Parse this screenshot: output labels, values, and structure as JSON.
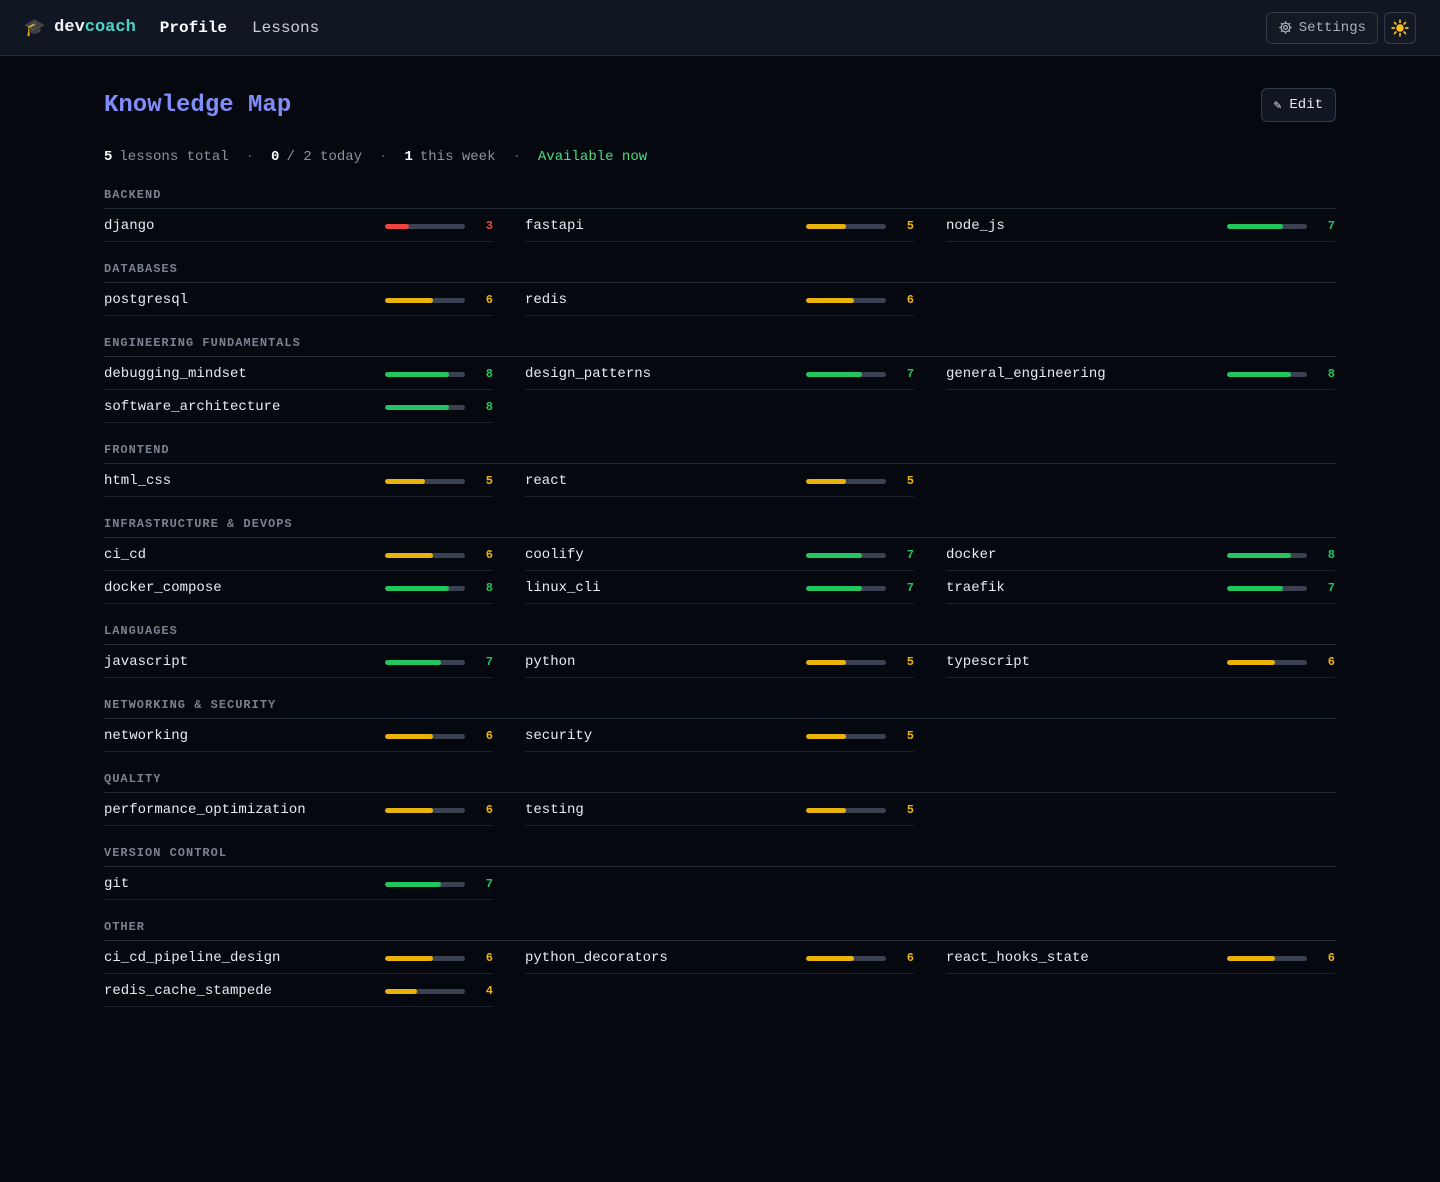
{
  "brand": {
    "icon": "graduation-cap-icon",
    "part1": "dev",
    "part2": "coach"
  },
  "nav": [
    {
      "label": "Profile",
      "active": true
    },
    {
      "label": "Lessons",
      "active": false
    }
  ],
  "header": {
    "settings_label": "Settings",
    "settings_icon": "gear-icon",
    "theme_icon": "sun-icon"
  },
  "page": {
    "title": "Knowledge Map",
    "edit_label": "Edit",
    "edit_icon": "pencil-icon"
  },
  "stats": {
    "lessons_total": "5",
    "lessons_total_label": "lessons total",
    "today_done": "0",
    "today_of": "/ 2 today",
    "week_count": "1",
    "week_label": "this week",
    "availability": "Available now"
  },
  "scale_max": 10,
  "colors": {
    "low": "#ef4444",
    "mid": "#eab308",
    "high": "#22c55e",
    "accent": "#818cf8",
    "brand": "#4fd1c5"
  },
  "sections": [
    {
      "title": "BACKEND",
      "skills": [
        {
          "name": "django",
          "score": 3
        },
        {
          "name": "fastapi",
          "score": 5
        },
        {
          "name": "node_js",
          "score": 7
        }
      ]
    },
    {
      "title": "DATABASES",
      "skills": [
        {
          "name": "postgresql",
          "score": 6
        },
        {
          "name": "redis",
          "score": 6
        }
      ]
    },
    {
      "title": "ENGINEERING FUNDAMENTALS",
      "skills": [
        {
          "name": "debugging_mindset",
          "score": 8
        },
        {
          "name": "design_patterns",
          "score": 7
        },
        {
          "name": "general_engineering",
          "score": 8
        },
        {
          "name": "software_architecture",
          "score": 8
        }
      ]
    },
    {
      "title": "FRONTEND",
      "skills": [
        {
          "name": "html_css",
          "score": 5
        },
        {
          "name": "react",
          "score": 5
        }
      ]
    },
    {
      "title": "INFRASTRUCTURE & DEVOPS",
      "skills": [
        {
          "name": "ci_cd",
          "score": 6
        },
        {
          "name": "coolify",
          "score": 7
        },
        {
          "name": "docker",
          "score": 8
        },
        {
          "name": "docker_compose",
          "score": 8
        },
        {
          "name": "linux_cli",
          "score": 7
        },
        {
          "name": "traefik",
          "score": 7
        }
      ]
    },
    {
      "title": "LANGUAGES",
      "skills": [
        {
          "name": "javascript",
          "score": 7
        },
        {
          "name": "python",
          "score": 5
        },
        {
          "name": "typescript",
          "score": 6
        }
      ]
    },
    {
      "title": "NETWORKING & SECURITY",
      "skills": [
        {
          "name": "networking",
          "score": 6
        },
        {
          "name": "security",
          "score": 5
        }
      ]
    },
    {
      "title": "QUALITY",
      "skills": [
        {
          "name": "performance_optimization",
          "score": 6
        },
        {
          "name": "testing",
          "score": 5
        }
      ]
    },
    {
      "title": "VERSION CONTROL",
      "skills": [
        {
          "name": "git",
          "score": 7
        }
      ]
    },
    {
      "title": "OTHER",
      "skills": [
        {
          "name": "ci_cd_pipeline_design",
          "score": 6
        },
        {
          "name": "python_decorators",
          "score": 6
        },
        {
          "name": "react_hooks_state",
          "score": 6
        },
        {
          "name": "redis_cache_stampede",
          "score": 4
        }
      ]
    }
  ]
}
